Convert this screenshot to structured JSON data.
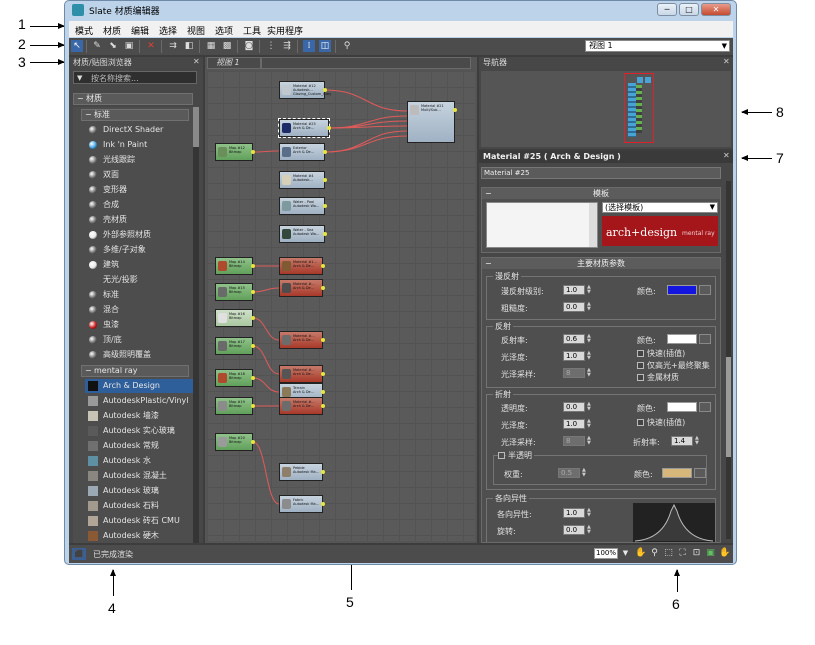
{
  "window": {
    "title": "Slate 材质编辑器",
    "controls": {
      "minimize": "─",
      "maximize": "□",
      "close": "✕"
    }
  },
  "menu": [
    "模式",
    "材质",
    "编辑",
    "选择",
    "视图",
    "选项",
    "工具",
    "实用程序"
  ],
  "toolbar": {
    "view_select": "视图 1",
    "icons": [
      "select-icon",
      "eyedropper-icon",
      "put-to-scene-icon",
      "assign-to-selection-icon",
      "delete-icon",
      "move-children-icon",
      "hide-unused-icon",
      "show-map-icon",
      "background-icon",
      "show-end-result-icon",
      "layout-vertical-icon",
      "layout-horizontal-icon",
      "material-id-icon",
      "select-by-material-icon",
      "search-icon"
    ]
  },
  "browser": {
    "title": "材质/贴图浏览器",
    "search_placeholder": "按名称搜索...",
    "group_top": "材质",
    "group_standard": "标准",
    "items_standard": [
      {
        "label": "DirectX Shader",
        "icon": "sphere-icon",
        "color": "#6a6a6a"
      },
      {
        "label": "Ink 'n Paint",
        "icon": "sphere-icon",
        "color": "#3ea0e0"
      },
      {
        "label": "光线跟踪",
        "icon": "sphere-icon",
        "color": "#777777"
      },
      {
        "label": "双面",
        "icon": "sphere-icon",
        "color": "#6a6a6a"
      },
      {
        "label": "变形器",
        "icon": "sphere-icon",
        "color": "#6a6a6a"
      },
      {
        "label": "合成",
        "icon": "sphere-icon",
        "color": "#6a6a6a"
      },
      {
        "label": "壳材质",
        "icon": "sphere-icon",
        "color": "#6a6a6a"
      },
      {
        "label": "外部参照材质",
        "icon": "sphere-icon",
        "color": "#e8e8e8"
      },
      {
        "label": "多维/子对象",
        "icon": "sphere-icon",
        "color": "#6a6a6a"
      },
      {
        "label": "建筑",
        "icon": "sphere-icon",
        "color": "#e8e8e8"
      },
      {
        "label": "无光/投影",
        "icon": "",
        "color": ""
      },
      {
        "label": "标准",
        "icon": "sphere-icon",
        "color": "#6a6a6a"
      },
      {
        "label": "混合",
        "icon": "sphere-icon",
        "color": "#6a6a6a"
      },
      {
        "label": "虫漆",
        "icon": "sphere-icon",
        "color": "#cc1b1b"
      },
      {
        "label": "顶/底",
        "icon": "sphere-icon",
        "color": "#6a6a6a"
      },
      {
        "label": "高级照明覆盖",
        "icon": "sphere-icon",
        "color": "#6a6a6a"
      }
    ],
    "group_mental_ray": "mental ray",
    "items_mental_ray": [
      {
        "label": "Arch & Design",
        "color": "#111111",
        "selected": true
      },
      {
        "label": "AutodeskPlastic/Vinyl",
        "color": "#9a9a9a"
      },
      {
        "label": "Autodesk 墙漆",
        "color": "#c7c4b6"
      },
      {
        "label": "Autodesk 实心玻璃",
        "color": "#5a5a5a"
      },
      {
        "label": "Autodesk 常规",
        "color": "#707070"
      },
      {
        "label": "Autodesk 水",
        "color": "#5e8fa3"
      },
      {
        "label": "Autodesk 混凝土",
        "color": "#8a8780"
      },
      {
        "label": "Autodesk 玻璃",
        "color": "#9aa9b3"
      },
      {
        "label": "Autodesk 石料",
        "color": "#a29a8c"
      },
      {
        "label": "Autodesk 砖石 CMU",
        "color": "#b0a597"
      },
      {
        "label": "Autodesk 硬木",
        "color": "#8a5a36"
      }
    ]
  },
  "view": {
    "tab_label": "视图 1",
    "nodes": [
      {
        "title": "Material #12",
        "sub": "Autodesk...",
        "line3": "Glazing_Custom_Grey",
        "color": "blue",
        "thumb": "#c0c7cf"
      },
      {
        "title": "Material #25",
        "sub": "Arch & De...",
        "line3": "",
        "color": "blue",
        "thumb": "#1d2c66",
        "selected": true
      },
      {
        "title": "Exterior",
        "sub": "Arch & De...",
        "line3": "",
        "color": "blue",
        "thumb": "#5a6e8a"
      },
      {
        "title": "Material #4",
        "sub": "Autodesk...",
        "line3": "",
        "color": "blue",
        "thumb": "#d6d0b8"
      },
      {
        "title": "Water - Pool",
        "sub": "Autodesk Wa...",
        "line3": "",
        "color": "blue",
        "thumb": "#7f9a9e"
      },
      {
        "title": "Water - Sea",
        "sub": "Autodesk Wa...",
        "line3": "",
        "color": "blue",
        "thumb": "#34493c"
      },
      {
        "title": "Map #12",
        "sub": "Bitmap",
        "line3": "",
        "color": "green",
        "thumb": "#6b8f5a"
      },
      {
        "title": "Map #14",
        "sub": "Bitmap",
        "line3": "",
        "color": "green",
        "thumb": "#b04a2c"
      },
      {
        "title": "Map #15",
        "sub": "Bitmap",
        "line3": "",
        "color": "green",
        "thumb": "#6a6a6a"
      },
      {
        "title": "Map #16",
        "sub": "Bitmap",
        "line3": "",
        "color": "ltgreen",
        "thumb": "#e0e0e0"
      },
      {
        "title": "Map #17",
        "sub": "Bitmap",
        "line3": "",
        "color": "green",
        "thumb": "#6a6a6a"
      },
      {
        "title": "Map #18",
        "sub": "Bitmap",
        "line3": "",
        "color": "green",
        "thumb": "#b04a2c"
      },
      {
        "title": "Map #19",
        "sub": "Bitmap",
        "line3": "",
        "color": "green",
        "thumb": "#8b8b8b"
      },
      {
        "title": "Map #20",
        "sub": "Bitmap",
        "line3": "",
        "color": "green",
        "thumb": "#9a9a9a"
      },
      {
        "title": "Material #1...",
        "sub": "Arch & De...",
        "line3": "",
        "color": "red",
        "thumb": "#7f5a32"
      },
      {
        "title": "Material #...",
        "sub": "Arch & De...",
        "line3": "",
        "color": "red",
        "thumb": "#4d4d4d"
      },
      {
        "title": "Material #...",
        "sub": "Arch & De...",
        "line3": "",
        "color": "red",
        "thumb": "#6c6c6c"
      },
      {
        "title": "Material #...",
        "sub": "Arch & De...",
        "line3": "",
        "color": "red",
        "thumb": "#555555"
      },
      {
        "title": "Terrain",
        "sub": "Arch & De...",
        "line3": "",
        "color": "blue",
        "thumb": "#8b7a5a"
      },
      {
        "title": "Material #...",
        "sub": "Arch & De...",
        "line3": "",
        "color": "red",
        "thumb": "#6c6c6c"
      },
      {
        "title": "Pebble",
        "sub": "Autodesk Ma...",
        "line3": "",
        "color": "blue",
        "thumb": "#8f7f6a"
      },
      {
        "title": "Fabric",
        "sub": "Autodesk Ma...",
        "line3": "",
        "color": "blue",
        "thumb": "#8c8c8c"
      },
      {
        "title": "Material #21",
        "sub": "Multi/Sub...",
        "line3": "",
        "color": "blue",
        "thumb": "#bcbcbc"
      }
    ]
  },
  "navigator": {
    "title": "导航器"
  },
  "params": {
    "title": "Material #25 ( Arch & Design )",
    "name_value": "Material #25",
    "templates": {
      "header": "模板",
      "select": "(选择模板)",
      "banner": "arch+design",
      "banner_sub": "mental ray"
    },
    "main": {
      "header": "主要材质参数",
      "diffuse": {
        "group": "漫反射",
        "level_label": "漫反射级别:",
        "level_value": "1.0",
        "roughness_label": "粗糙度:",
        "roughness_value": "0.0",
        "color_label": "颜色:",
        "color": "#1515e0"
      },
      "reflection": {
        "group": "反射",
        "refl_label": "反射率:",
        "refl_value": "0.6",
        "gloss_label": "光泽度:",
        "gloss_value": "1.0",
        "samples_label": "光泽采样:",
        "samples_value": "8",
        "color_label": "颜色:",
        "color": "#ffffff",
        "cb_fast": "快速(插值)",
        "cb_highlights": "仅高光+最终聚集",
        "cb_metal": "金属材质"
      },
      "refraction": {
        "group": "折射",
        "trans_label": "透明度:",
        "trans_value": "0.0",
        "gloss_label": "光泽度:",
        "gloss_value": "1.0",
        "samples_label": "光泽采样:",
        "samples_value": "8",
        "color_label": "颜色:",
        "color": "#ffffff",
        "cb_fast": "快速(插值)",
        "ior_label": "折射率:",
        "ior_value": "1.4"
      },
      "translucency": {
        "cb_label": "半透明",
        "weight_label": "权重:",
        "weight_value": "0.5",
        "color_label": "颜色:",
        "color": "#d8b87a"
      },
      "anisotropy": {
        "group": "各向异性",
        "aniso_label": "各向异性:",
        "aniso_value": "1.0",
        "rotation_label": "旋转:",
        "rotation_value": "0.0"
      }
    }
  },
  "status": {
    "text": "已完成渲染",
    "zoom": "100%"
  },
  "callouts": [
    "1",
    "2",
    "3",
    "4",
    "5",
    "6",
    "7",
    "8"
  ]
}
